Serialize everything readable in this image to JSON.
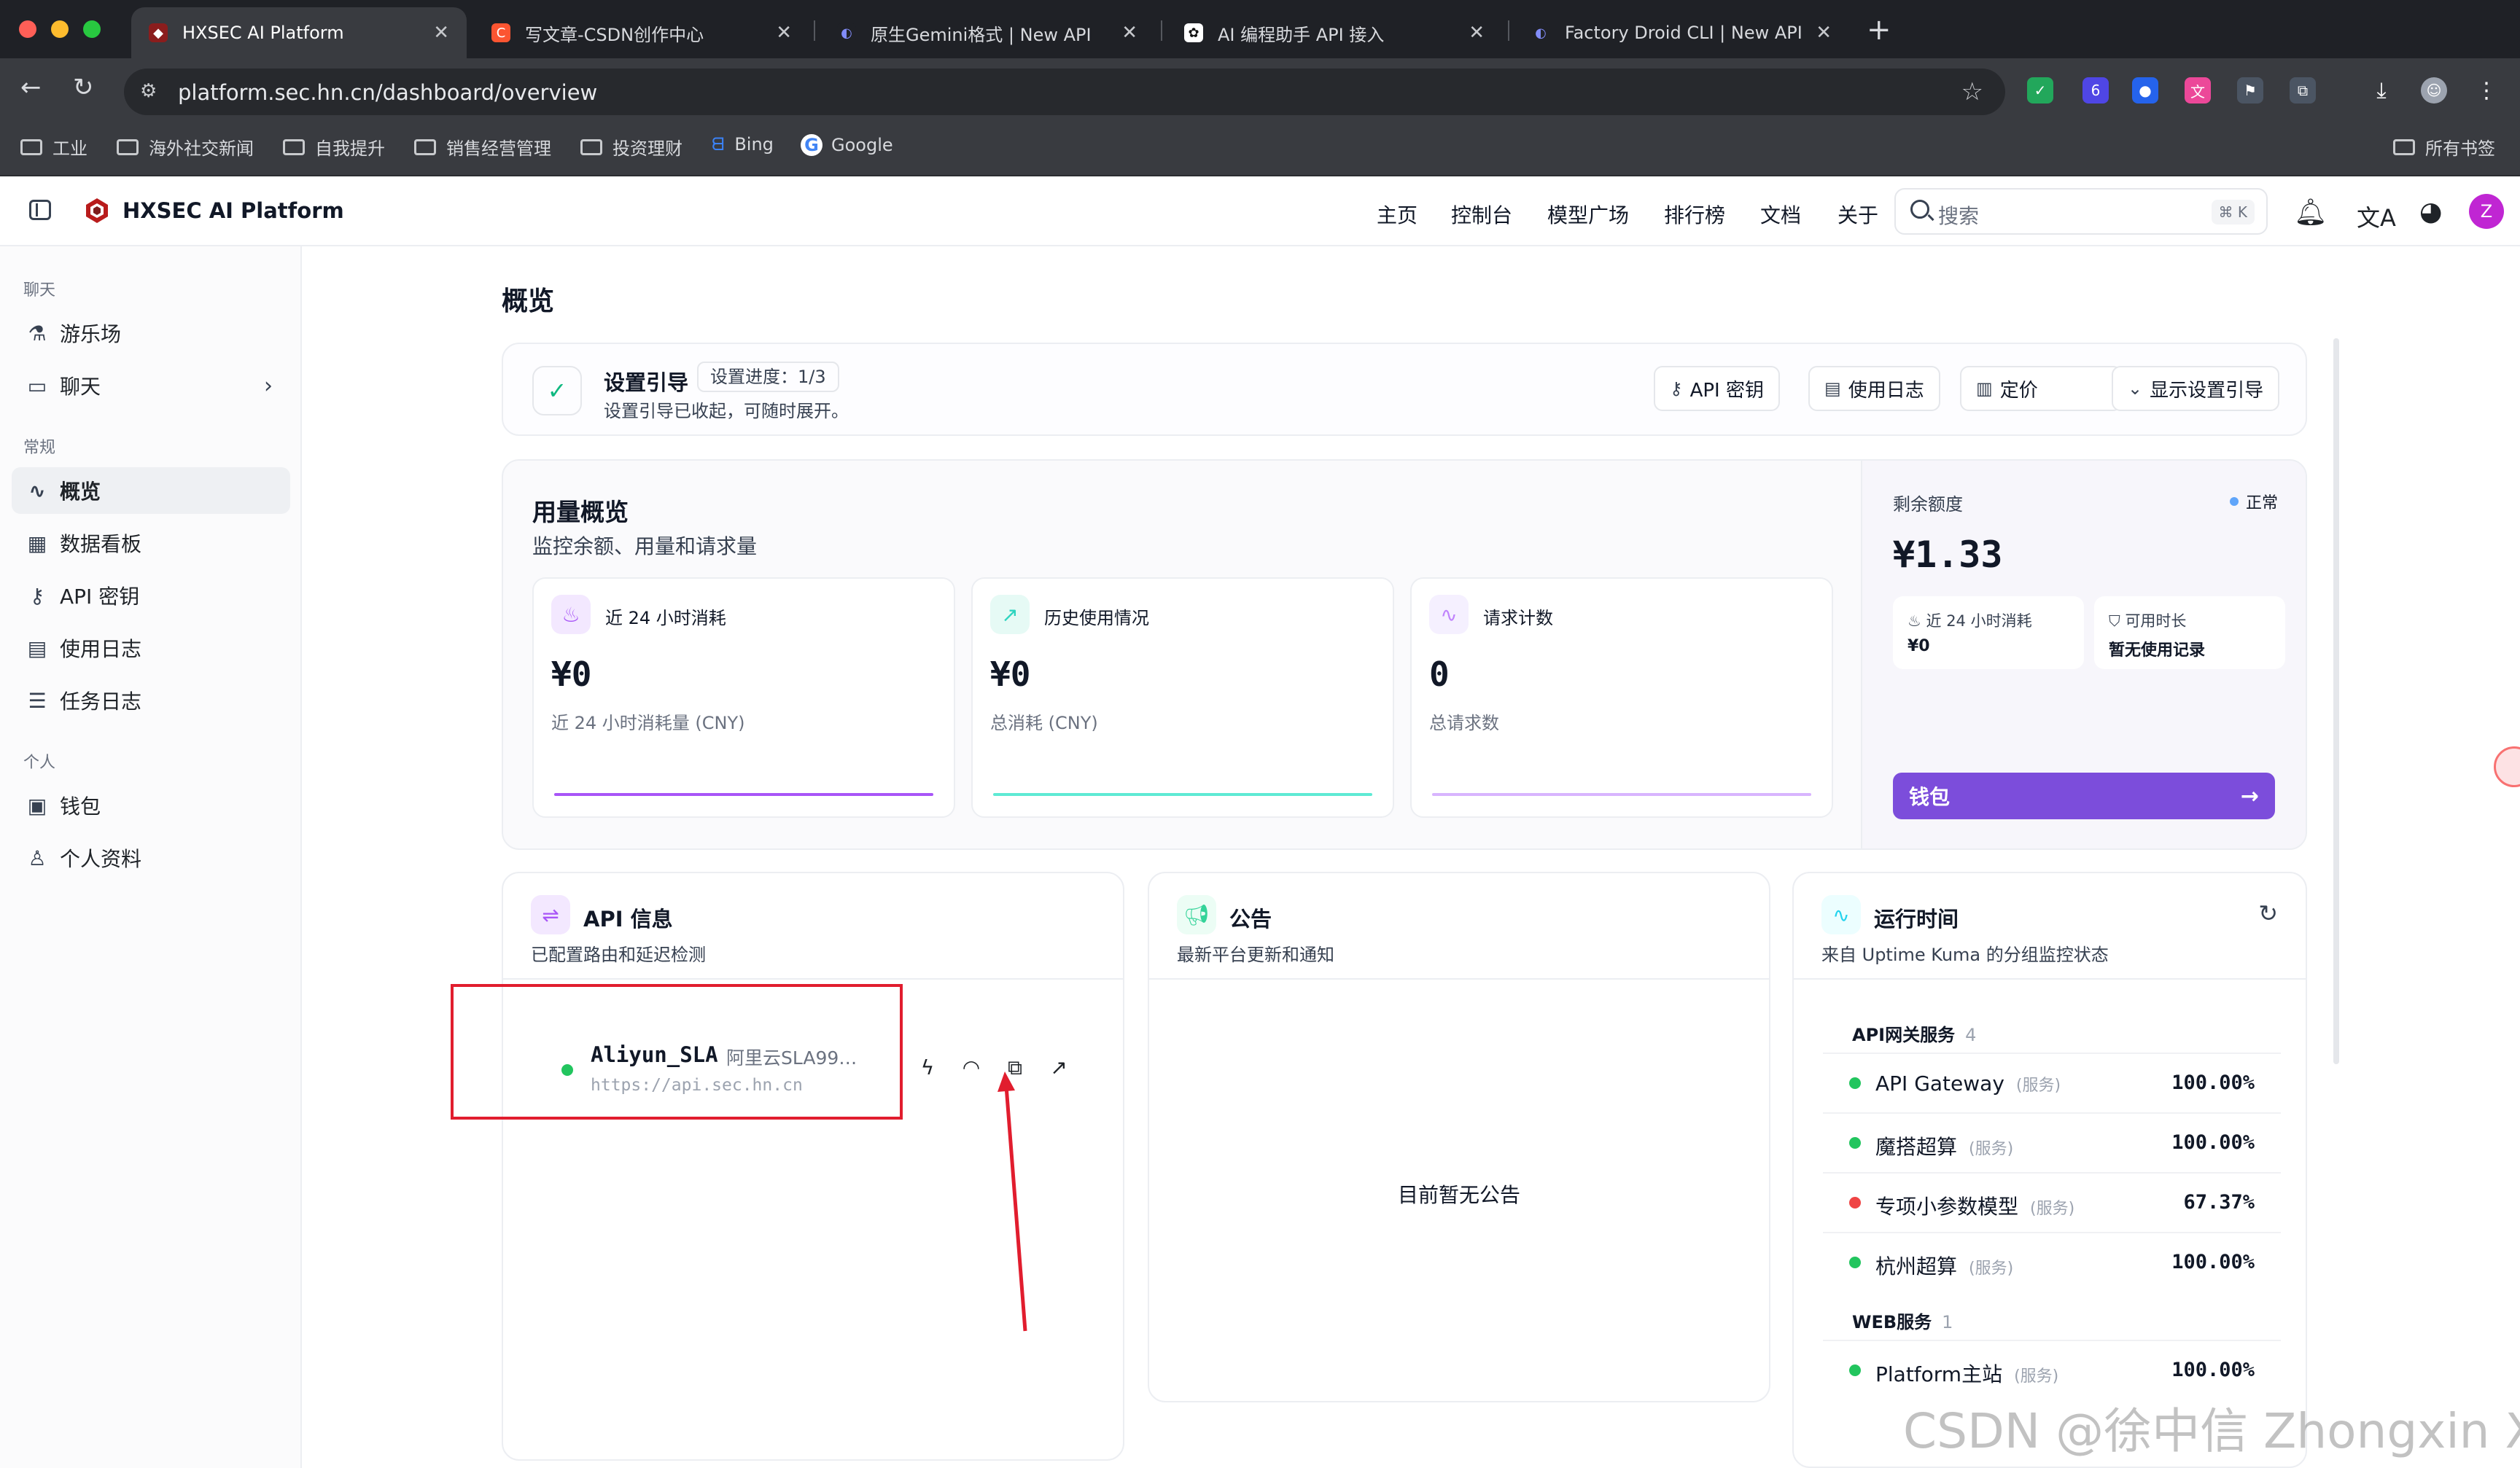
{
  "browser": {
    "tabs": [
      {
        "title": "HXSEC AI Platform",
        "active": true
      },
      {
        "title": "写文章-CSDN创作中心",
        "active": false
      },
      {
        "title": "原生Gemini格式 | New API",
        "active": false
      },
      {
        "title": "AI 编程助手 API 接入",
        "active": false
      },
      {
        "title": "Factory Droid CLI | New API",
        "active": false
      }
    ],
    "url": "platform.sec.hn.cn/dashboard/overview",
    "extension_badge": "6",
    "bookmarks": [
      "工业",
      "海外社交新闻",
      "自我提升",
      "销售经营管理",
      "投资理财",
      "Bing",
      "Google"
    ],
    "all_bookmarks": "所有书签"
  },
  "app": {
    "brand": "HXSEC AI Platform",
    "nav": [
      "主页",
      "控制台",
      "模型广场",
      "排行榜",
      "文档",
      "关于"
    ],
    "search_placeholder": "搜索",
    "search_shortcut": "⌘ K",
    "avatar_letter": "Z"
  },
  "sidebar": {
    "groups": [
      {
        "label": "聊天",
        "items": [
          {
            "label": "游乐场",
            "icon": "flask-icon"
          },
          {
            "label": "聊天",
            "icon": "chat-icon",
            "has_chevron": true
          }
        ]
      },
      {
        "label": "常规",
        "items": [
          {
            "label": "概览",
            "icon": "activity-icon",
            "active": true
          },
          {
            "label": "数据看板",
            "icon": "grid-icon"
          },
          {
            "label": "API 密钥",
            "icon": "key-icon"
          },
          {
            "label": "使用日志",
            "icon": "file-icon"
          },
          {
            "label": "任务日志",
            "icon": "list-icon"
          }
        ]
      },
      {
        "label": "个人",
        "items": [
          {
            "label": "钱包",
            "icon": "wallet-icon"
          },
          {
            "label": "个人资料",
            "icon": "user-icon"
          }
        ]
      }
    ]
  },
  "page": {
    "title": "概览",
    "guide": {
      "title": "设置引导",
      "progress": "设置进度：1/3",
      "subtitle": "设置引导已收起，可随时展开。",
      "buttons": [
        "API 密钥",
        "使用日志",
        "定价",
        "显示设置引导"
      ]
    },
    "usage": {
      "title": "用量概览",
      "subtitle": "监控余额、用量和请求量",
      "stats": [
        {
          "label": "近 24 小时消耗",
          "value": "¥0",
          "caption": "近 24 小时消耗量 (CNY)",
          "color": "#a855f7"
        },
        {
          "label": "历史使用情况",
          "value": "¥0",
          "caption": "总消耗 (CNY)",
          "color": "#5eead4"
        },
        {
          "label": "请求计数",
          "value": "0",
          "caption": "总请求数",
          "color": "#d8b4fe"
        }
      ],
      "quota": {
        "label": "剩余额度",
        "status": "正常",
        "value": "¥1.33",
        "box1_label": "近 24 小时消耗",
        "box1_value": "¥0",
        "box2_label": "可用时长",
        "box2_value": "暂无使用记录",
        "wallet_label": "钱包"
      }
    },
    "api_info": {
      "title": "API 信息",
      "subtitle": "已配置路由和延迟检测",
      "route": {
        "name": "Aliyun_SLA",
        "desc": "阿里云SLA99....",
        "url": "https://api.sec.hn.cn"
      }
    },
    "notice": {
      "title": "公告",
      "subtitle": "最新平台更新和通知",
      "empty": "目前暂无公告"
    },
    "uptime": {
      "title": "运行时间",
      "subtitle": "来自 Uptime Kuma 的分组监控状态",
      "groups": [
        {
          "name": "API网关服务",
          "count": "4",
          "services": [
            {
              "name": "API Gateway",
              "type": "(服务)",
              "pct": "100.00%",
              "status": "up"
            },
            {
              "name": "魔搭超算",
              "type": "(服务)",
              "pct": "100.00%",
              "status": "up"
            },
            {
              "name": "专项小参数模型",
              "type": "(服务)",
              "pct": "67.37%",
              "status": "down"
            },
            {
              "name": "杭州超算",
              "type": "(服务)",
              "pct": "100.00%",
              "status": "up"
            }
          ]
        },
        {
          "name": "WEB服务",
          "count": "1",
          "services": [
            {
              "name": "Platform主站",
              "type": "(服务)",
              "pct": "100.00%",
              "status": "up"
            }
          ]
        }
      ]
    }
  },
  "watermark": "CSDN @徐中信 Zhongxin Xu",
  "colors": {
    "accent": "#7c4ddb",
    "up": "#22c55e",
    "down": "#ef4444",
    "annotation": "#e11d2e"
  }
}
